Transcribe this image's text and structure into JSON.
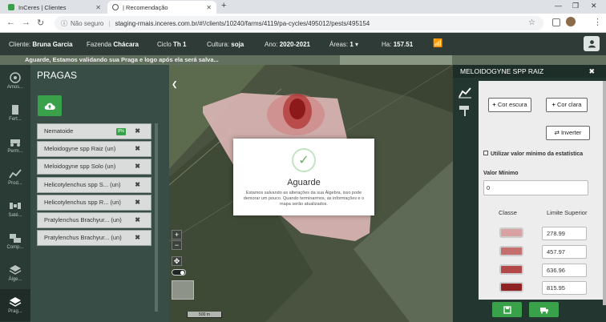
{
  "browser": {
    "tabs": [
      {
        "label": "InCeres | Clientes",
        "active": false
      },
      {
        "label": "| Recomendação",
        "active": true
      }
    ],
    "security_label": "Não seguro",
    "url": "staging-rmais.inceres.com.br/#!/clients/10240/farms/4119/pa-cycles/495012/pests/495154"
  },
  "header": {
    "cliente_label": "Cliente:",
    "cliente_value": "Bruna Garcia",
    "fazenda_label": "Fazenda",
    "fazenda_value": "Chácara",
    "ciclo_label": "Ciclo",
    "ciclo_value": "Th 1",
    "cultura_label": "Cultura:",
    "cultura_value": "soja",
    "ano_label": "Ano:",
    "ano_value": "2020-2021",
    "areas_label": "Áreas:",
    "areas_value": "1",
    "ha_label": "Ha:",
    "ha_value": "157.51"
  },
  "notice": "Aguarde, Estamos validando sua Praga e logo após ela será salva...",
  "rail": [
    {
      "label": "Amos...",
      "icon": "sample-icon"
    },
    {
      "label": "Fert...",
      "icon": "fertilizer-icon"
    },
    {
      "label": "Perm...",
      "icon": "tractor-icon"
    },
    {
      "label": "Prod...",
      "icon": "chart-line-icon"
    },
    {
      "label": "Saté...",
      "icon": "satellite-icon"
    },
    {
      "label": "Comp...",
      "icon": "compare-icon"
    },
    {
      "label": "Álge...",
      "icon": "layers-icon"
    },
    {
      "label": "Prag...",
      "icon": "layers-stack-icon"
    }
  ],
  "pragas": {
    "title": "PRAGAS",
    "items": [
      {
        "label": "Nematoide",
        "badge": "8%"
      },
      {
        "label": "Meloidogyne spp Raiz (un)",
        "badge": ""
      },
      {
        "label": "Meloidogyne spp Solo (un)",
        "badge": ""
      },
      {
        "label": "Helicotylenchus spp S... (un)",
        "badge": ""
      },
      {
        "label": "Helicotylenchus spp R... (un)",
        "badge": ""
      },
      {
        "label": "Pratylenchus Brachyur... (un)",
        "badge": ""
      },
      {
        "label": "Pratylenchus Brachyur... (un)",
        "badge": ""
      }
    ]
  },
  "map": {
    "zoom_in": "+",
    "zoom_out": "−",
    "scale": "500 m"
  },
  "modal": {
    "title": "Aguarde",
    "message": "Estamos salvando as alterações da sua Álgebra, isso pode demorar um pouco. Quando terminarmos, as informações e o mapa serão atualizados."
  },
  "right_panel": {
    "title": "MELOIDOGYNE SPP RAIZ",
    "cor_escura": "Cor escura",
    "cor_clara": "Cor clara",
    "inverter": "Inverter",
    "min_check_label": "Utilizar valor mínimo da estatística",
    "valor_minimo_label": "Valor Mínimo",
    "valor_minimo_value": "0",
    "col_classe": "Classe",
    "col_limite": "Limite Superior",
    "classes": [
      {
        "color": "#d8a2a2",
        "limit": "278.99"
      },
      {
        "color": "#c46e6e",
        "limit": "457.97"
      },
      {
        "color": "#b24848",
        "limit": "636.96"
      },
      {
        "color": "#8f2222",
        "limit": "815.95"
      }
    ]
  },
  "colors": {
    "accent_green": "#3aa14b",
    "header_bg": "#2e3b36"
  }
}
